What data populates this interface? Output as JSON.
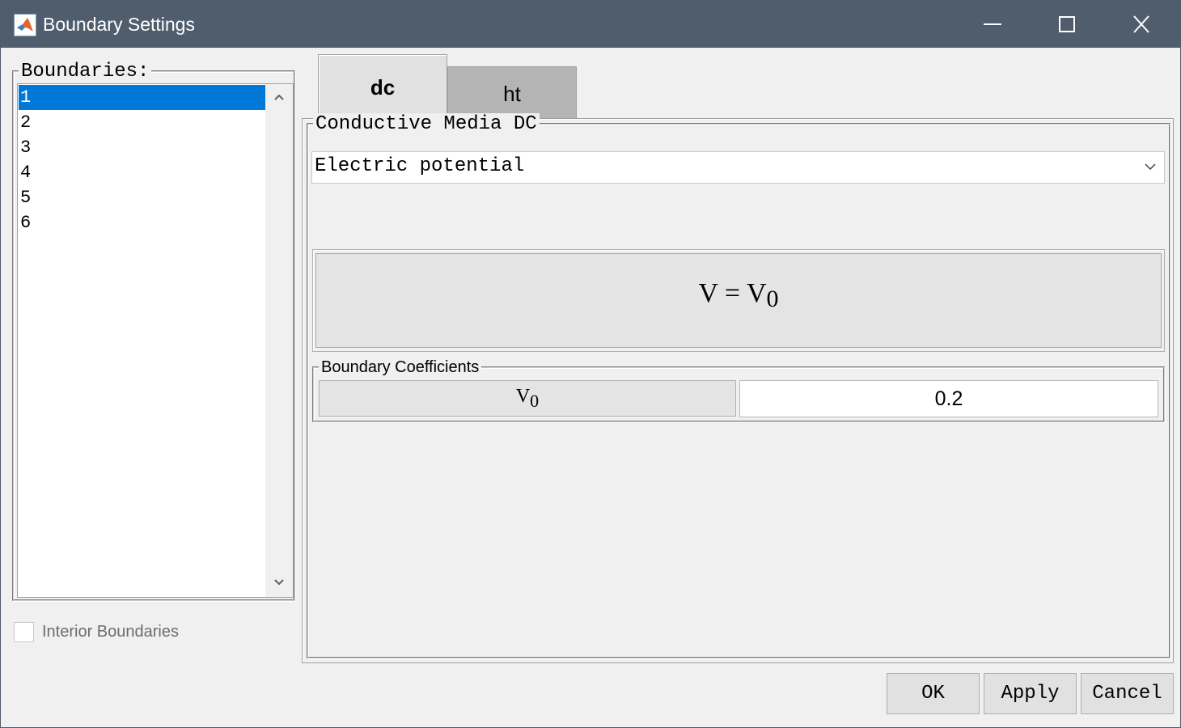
{
  "window": {
    "title": "Boundary Settings"
  },
  "boundaries": {
    "title": "Boundaries:",
    "items": [
      "1",
      "2",
      "3",
      "4",
      "5",
      "6"
    ],
    "selected": "1"
  },
  "interior_boundaries": {
    "label": "Interior Boundaries",
    "checked": false
  },
  "tabs": [
    {
      "label": "dc",
      "active": true
    },
    {
      "label": "ht",
      "active": false
    }
  ],
  "media": {
    "title": "Conductive Media DC",
    "condition": "Electric potential"
  },
  "equation": {
    "lhs": "V = V",
    "sub": "0"
  },
  "coefficients": {
    "title": "Boundary Coefficients",
    "symbol": "V",
    "symbol_sub": "0",
    "value": "0.2"
  },
  "buttons": {
    "ok": "OK",
    "apply": "Apply",
    "cancel": "Cancel"
  },
  "colors": {
    "titlebar": "#505d6d",
    "selection": "#0078d7"
  }
}
